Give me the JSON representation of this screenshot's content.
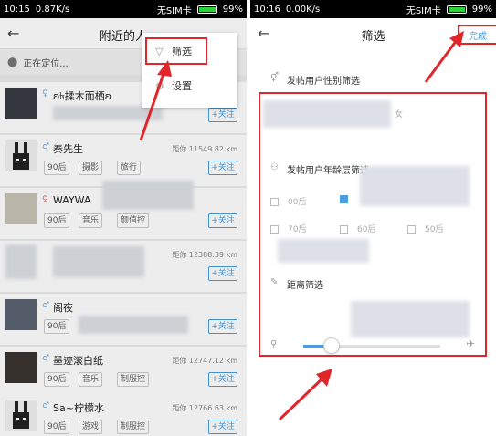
{
  "left": {
    "status": {
      "time": "10:15",
      "speed": "0.87K/s",
      "sim": "无SIM卡",
      "battery": "99%"
    },
    "title": "附近的人",
    "location": "正在定位...",
    "menu": {
      "filter": "筛选",
      "settings": "设置"
    },
    "users": [
      {
        "name": "ʚ৳揉木而栖ʚ",
        "tags": [],
        "distance": "",
        "add": "+关注"
      },
      {
        "name": "秦先生",
        "tags": [
          "90后",
          "摄影",
          "旅行"
        ],
        "distance": "距你 11549.82 km",
        "add": "+关注"
      },
      {
        "name": "WAYWA",
        "tags": [
          "90后",
          "音乐",
          "颜值控"
        ],
        "distance": "",
        "add": "+关注"
      },
      {
        "name": "",
        "tags": [],
        "distance": "距你 12388.39 km",
        "add": "+关注"
      },
      {
        "name": "阁夜",
        "tags": [
          "90后"
        ],
        "distance": "",
        "add": "+关注"
      },
      {
        "name": "墨迹滚白纸",
        "tags": [
          "90后",
          "音乐",
          "制服控"
        ],
        "distance": "距你 12747.12 km",
        "add": "+关注"
      },
      {
        "name": "Sa~柠檬水",
        "tags": [
          "90后",
          "游戏",
          "制服控"
        ],
        "distance": "距你 12766.63 km",
        "add": "+关注"
      }
    ]
  },
  "right": {
    "status": {
      "time": "10:16",
      "speed": "0.00K/s",
      "sim": "无SIM卡",
      "battery": "99%"
    },
    "title": "筛选",
    "done": "完成",
    "gender_label": "发帖用户性别筛选",
    "gender_female": "女",
    "age_label": "发帖用户年龄层筛选",
    "age_options": [
      "00后",
      "70后",
      "60后",
      "50后"
    ],
    "distance_label": "距离筛选"
  },
  "colors": {
    "accent": "#4a9de0",
    "annotation": "#e0262b"
  }
}
